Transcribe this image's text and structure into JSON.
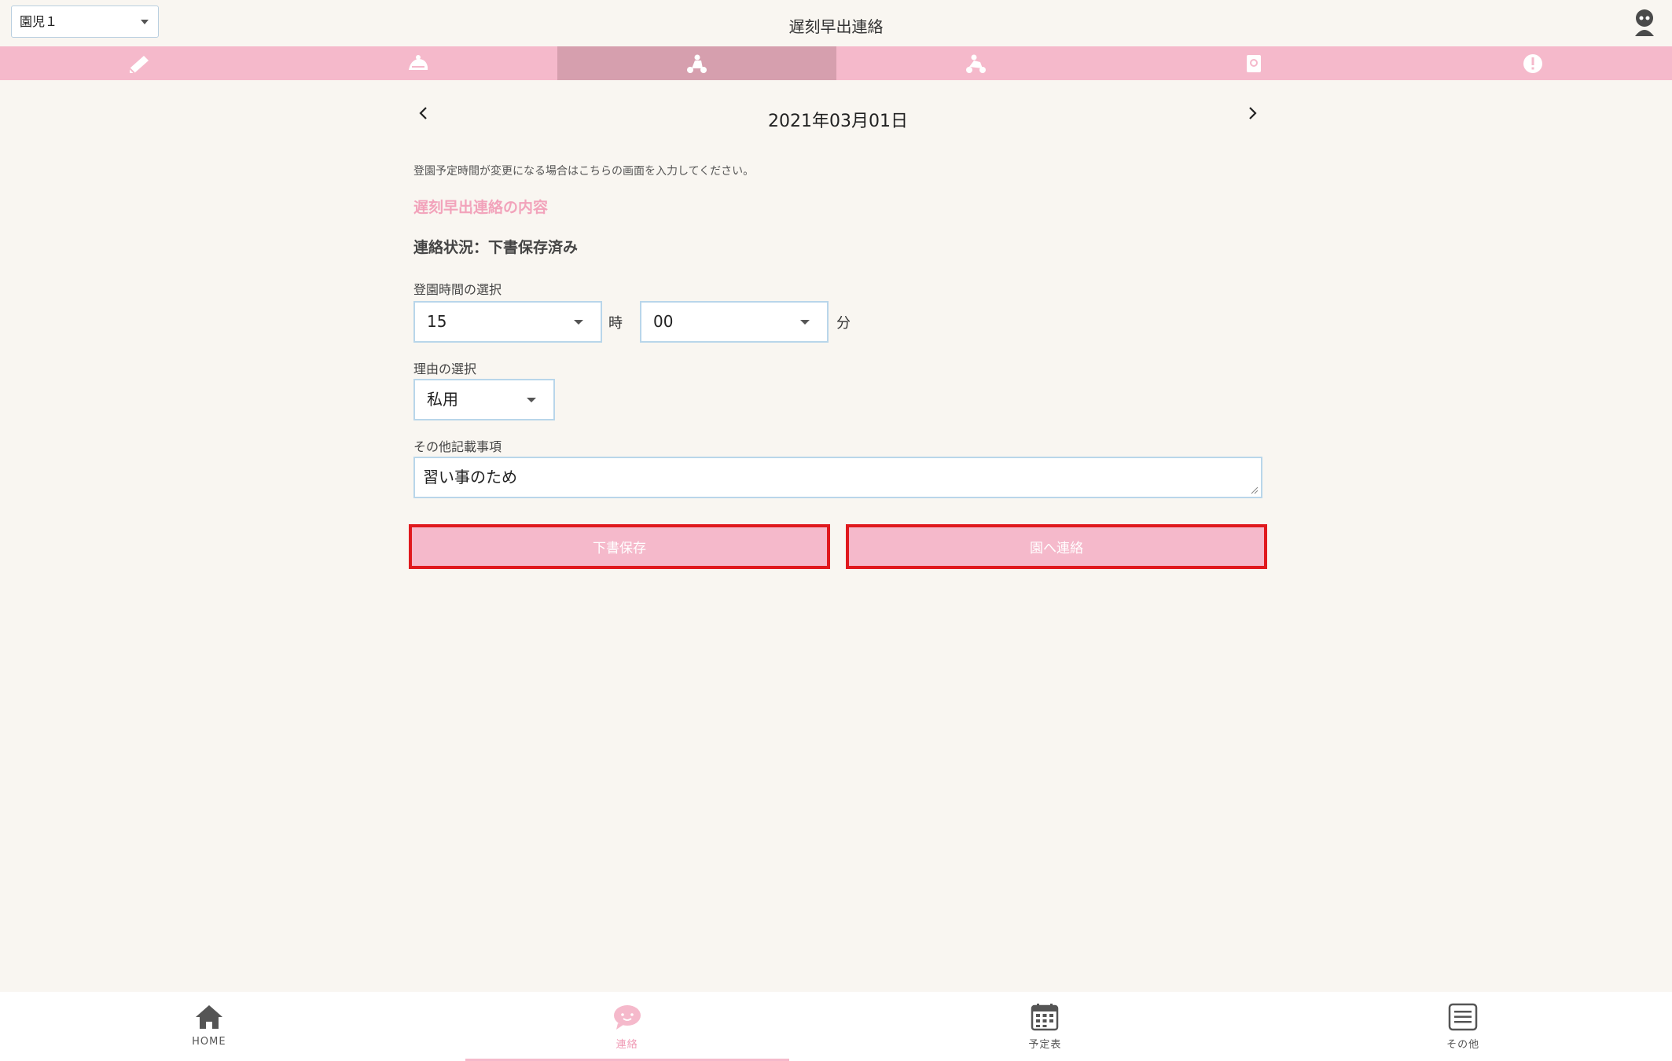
{
  "header": {
    "child_select": "園児１",
    "title": "遅刻早出連絡"
  },
  "category_tabs": [
    {
      "icon": "pencil-icon",
      "active": false
    },
    {
      "icon": "thermometer-icon",
      "active": false
    },
    {
      "icon": "tricycle-icon",
      "active": true
    },
    {
      "icon": "tricycle-alt-icon",
      "active": false
    },
    {
      "icon": "cup-icon",
      "active": false
    },
    {
      "icon": "exclamation-icon",
      "active": false
    }
  ],
  "date_nav": {
    "date": "2021年03月01日"
  },
  "form": {
    "notice": "登園予定時間が変更になる場合はこちらの画面を入力してください。",
    "section_title": "遅刻早出連絡の内容",
    "status": "連絡状況：下書保存済み",
    "time_label": "登園時間の選択",
    "hour_value": "15",
    "hour_unit": "時",
    "minute_value": "00",
    "minute_unit": "分",
    "reason_label": "理由の選択",
    "reason_value": "私用",
    "other_label": "その他記載事項",
    "other_value": "習い事のため",
    "draft_button": "下書保存",
    "send_button": "園へ連絡"
  },
  "colors": {
    "accent_pink": "#f5b9cb",
    "active_tab": "#d69fae",
    "highlight_red": "#e0191e",
    "section_pink": "#f2a3bb"
  },
  "bottom_nav": [
    {
      "label": "HOME",
      "icon": "home-icon",
      "active": false
    },
    {
      "label": "連絡",
      "icon": "chat-face-icon",
      "active": true
    },
    {
      "label": "予定表",
      "icon": "calendar-icon",
      "active": false
    },
    {
      "label": "その他",
      "icon": "menu-icon",
      "active": false
    }
  ]
}
